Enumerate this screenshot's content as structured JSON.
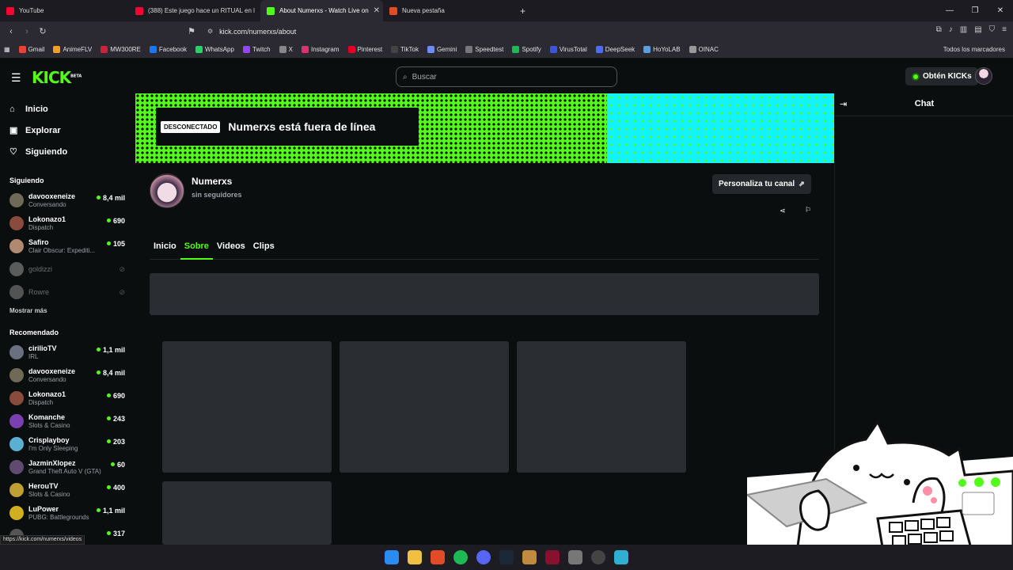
{
  "browser": {
    "tabs": [
      {
        "title": "YouTube",
        "color": "#ff0033"
      },
      {
        "title": "(388) Este juego hace un RITUAL en l",
        "color": "#ff0033"
      },
      {
        "title": "About Numerxs - Watch Live on",
        "color": "#53fc18",
        "active": true
      },
      {
        "title": "Nueva pestaña",
        "color": "#e34b26"
      }
    ],
    "url": "kick.com/numerxs/about",
    "bookmarks": [
      {
        "label": "Gmail",
        "color": "#ea4335"
      },
      {
        "label": "AnimeFLV",
        "color": "#f0a020"
      },
      {
        "label": "MW300RE",
        "color": "#d0213a"
      },
      {
        "label": "Facebook",
        "color": "#1877f2"
      },
      {
        "label": "WhatsApp",
        "color": "#25d366"
      },
      {
        "label": "Twitch",
        "color": "#9146ff"
      },
      {
        "label": "X",
        "color": "#888888"
      },
      {
        "label": "Instagram",
        "color": "#e1306c"
      },
      {
        "label": "Pinterest",
        "color": "#e60023"
      },
      {
        "label": "TikTok",
        "color": "#444444"
      },
      {
        "label": "Gemini",
        "color": "#6b8df5"
      },
      {
        "label": "Speedtest",
        "color": "#777777"
      },
      {
        "label": "Spotify",
        "color": "#1db954"
      },
      {
        "label": "VirusTotal",
        "color": "#3955e0"
      },
      {
        "label": "DeepSeek",
        "color": "#4d6bfe"
      },
      {
        "label": "HoYoLAB",
        "color": "#5aa0e0"
      },
      {
        "label": "OINAC",
        "color": "#999999"
      }
    ],
    "bookmarks_right": "Todos los marcadores",
    "status_url": "https://kick.com/numerxs/videos"
  },
  "header": {
    "search_placeholder": "Buscar",
    "kicks_label": "Obtén KICKs",
    "accent": "#53fc18"
  },
  "sidebar": {
    "nav": [
      {
        "label": "Inicio",
        "icon": "home-icon",
        "glyph": "⌂"
      },
      {
        "label": "Explorar",
        "icon": "compass-icon",
        "glyph": "▣"
      },
      {
        "label": "Siguiendo",
        "icon": "heart-icon",
        "glyph": "♡"
      }
    ],
    "following_title": "Siguiendo",
    "following": [
      {
        "name": "davooxeneize",
        "category": "Conversando",
        "viewers": "8,4 mil",
        "color": "#6f6a55",
        "online": true
      },
      {
        "name": "Lokonazo1",
        "category": "Dispatch",
        "viewers": "690",
        "color": "#8a4b3c",
        "online": true
      },
      {
        "name": "Safiro",
        "category": "Clair Obscur: Expediti...",
        "viewers": "105",
        "color": "#b08a70",
        "online": true
      },
      {
        "name": "goldizzi",
        "category": "",
        "viewers": "⊘",
        "color": "#aaaaaa",
        "online": false
      },
      {
        "name": "Rowre",
        "category": "",
        "viewers": "⊘",
        "color": "#999999",
        "online": false
      }
    ],
    "show_more": "Mostrar más",
    "recommended_title": "Recomendado",
    "recommended": [
      {
        "name": "cirilioTV",
        "category": "IRL",
        "viewers": "1,1 mil",
        "color": "#6a7080"
      },
      {
        "name": "davooxeneize",
        "category": "Conversando",
        "viewers": "8,4 mil",
        "color": "#6f6a55"
      },
      {
        "name": "Lokonazo1",
        "category": "Dispatch",
        "viewers": "690",
        "color": "#8a4b3c"
      },
      {
        "name": "Komanche",
        "category": "Slots & Casino",
        "viewers": "243",
        "color": "#7a3fb0"
      },
      {
        "name": "Crisplayboy",
        "category": "I'm Only Sleeping",
        "viewers": "203",
        "color": "#5ab0d0"
      },
      {
        "name": "JazminXlopez",
        "category": "Grand Theft Auto V (GTA)",
        "viewers": "60",
        "color": "#604a70"
      },
      {
        "name": "HerouTV",
        "category": "Slots & Casino",
        "viewers": "400",
        "color": "#c0a030"
      },
      {
        "name": "LuPower",
        "category": "PUBG: Battlegrounds",
        "viewers": "1,1 mil",
        "color": "#d0b020"
      },
      {
        "name": "",
        "category": "",
        "viewers": "317",
        "color": "#555555"
      }
    ]
  },
  "banner": {
    "badge": "DESCONECTADO",
    "text": "Numerxs está fuera de línea"
  },
  "chat": {
    "title": "Chat"
  },
  "profile": {
    "name": "Numerxs",
    "followers": "sin seguidores",
    "customize_label": "Personaliza tu canal"
  },
  "channel_tabs": [
    {
      "label": "Inicio",
      "active": false
    },
    {
      "label": "Sobre",
      "active": true
    },
    {
      "label": "Videos",
      "active": false
    },
    {
      "label": "Clips",
      "active": false
    }
  ]
}
